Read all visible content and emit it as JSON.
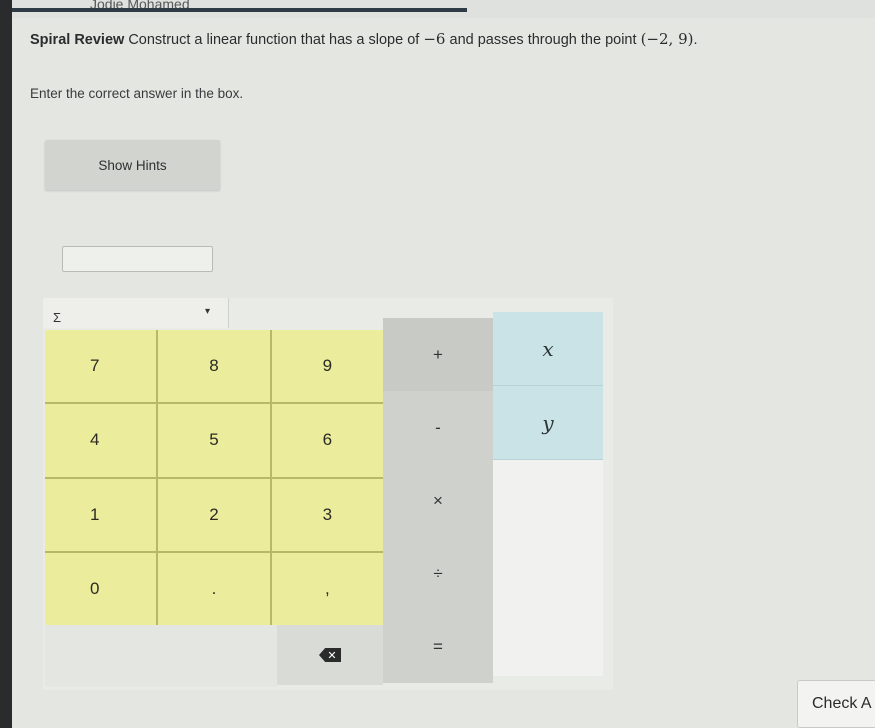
{
  "header": {
    "student_name": "Jodie Mohamed"
  },
  "question": {
    "label": "Spiral Review",
    "text_before": "Construct a linear function that has a slope of",
    "slope": "−6",
    "text_middle": "and passes through the point",
    "point": "(−2, 9)",
    "text_after": "."
  },
  "instruction": "Enter the correct answer in the box.",
  "hints_button": "Show Hints",
  "answer": {
    "value": ""
  },
  "keypad": {
    "menu_symbol": "Σ",
    "menu_caret": "▾",
    "digits": [
      "7",
      "8",
      "9",
      "4",
      "5",
      "6",
      "1",
      "2",
      "3",
      "0",
      ".",
      ","
    ],
    "operators": [
      "+",
      "-",
      "×",
      "÷",
      "="
    ],
    "variables": [
      "x",
      "y"
    ],
    "backspace_label": "✕"
  },
  "check_button": "Check A"
}
